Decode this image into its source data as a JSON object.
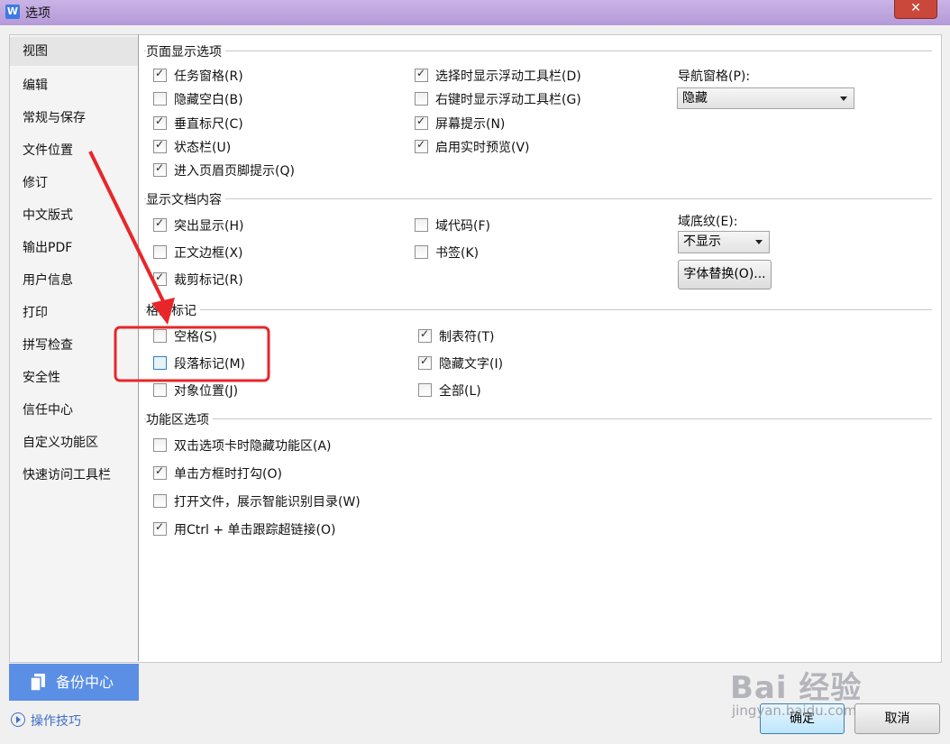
{
  "window": {
    "title": "选项",
    "app_icon": "W",
    "close_glyph": "✕"
  },
  "sidebar": {
    "items": [
      {
        "label": "视图",
        "selected": true
      },
      {
        "label": "编辑"
      },
      {
        "label": "常规与保存"
      },
      {
        "label": "文件位置"
      },
      {
        "label": "修订"
      },
      {
        "label": "中文版式"
      },
      {
        "label": "输出PDF"
      },
      {
        "label": "用户信息"
      },
      {
        "label": "打印"
      },
      {
        "label": "拼写检查"
      },
      {
        "label": "安全性"
      },
      {
        "label": "信任中心"
      },
      {
        "label": "自定义功能区"
      },
      {
        "label": "快速访问工具栏"
      }
    ],
    "backup_label": "备份中心",
    "tips_label": "操作技巧"
  },
  "page_display": {
    "title": "页面显示选项",
    "options": [
      {
        "label": "任务窗格(R)",
        "checked": true
      },
      {
        "label": "隐藏空白(B)",
        "checked": false
      },
      {
        "label": "垂直标尺(C)",
        "checked": true
      },
      {
        "label": "状态栏(U)",
        "checked": true
      },
      {
        "label": "进入页眉页脚提示(Q)",
        "checked": true
      },
      {
        "label": "选择时显示浮动工具栏(D)",
        "checked": true
      },
      {
        "label": "右键时显示浮动工具栏(G)",
        "checked": false
      },
      {
        "label": "屏幕提示(N)",
        "checked": true
      },
      {
        "label": "启用实时预览(V)",
        "checked": true
      }
    ],
    "nav_pane_label": "导航窗格(P):",
    "nav_pane_value": "隐藏"
  },
  "doc_content": {
    "title": "显示文档内容",
    "options": [
      {
        "label": "突出显示(H)",
        "checked": true
      },
      {
        "label": "正文边框(X)",
        "checked": false
      },
      {
        "label": "裁剪标记(R)",
        "checked": true
      },
      {
        "label": "域代码(F)",
        "checked": false
      },
      {
        "label": "书签(K)",
        "checked": false
      }
    ],
    "field_shading_label": "域底纹(E):",
    "field_shading_value": "不显示",
    "font_sub_button": "字体替换(O)..."
  },
  "format_marks": {
    "title": "格式标记",
    "options": [
      {
        "label": "空格(S)",
        "checked": false
      },
      {
        "label": "段落标记(M)",
        "checked": false,
        "highlighted": true
      },
      {
        "label": "对象位置(J)",
        "checked": false
      },
      {
        "label": "制表符(T)",
        "checked": true
      },
      {
        "label": "隐藏文字(I)",
        "checked": true
      },
      {
        "label": "全部(L)",
        "checked": false
      }
    ]
  },
  "ribbon": {
    "title": "功能区选项",
    "options": [
      {
        "label": "双击选项卡时隐藏功能区(A)",
        "checked": false
      },
      {
        "label": "单击方框时打勾(O)",
        "checked": true
      },
      {
        "label": "打开文件，展示智能识别目录(W)",
        "checked": false
      },
      {
        "label": "用Ctrl + 单击跟踪超链接(O)",
        "checked": true
      }
    ]
  },
  "footer": {
    "ok_label": "确定",
    "cancel_label": "取消"
  },
  "watermark": {
    "logo": "Bai  经验",
    "url": "jingyan.baidu.com"
  },
  "colors": {
    "accent": "#5b8fe6",
    "annotation_red": "#e8262a",
    "title_bar": "#c2a8e2"
  }
}
